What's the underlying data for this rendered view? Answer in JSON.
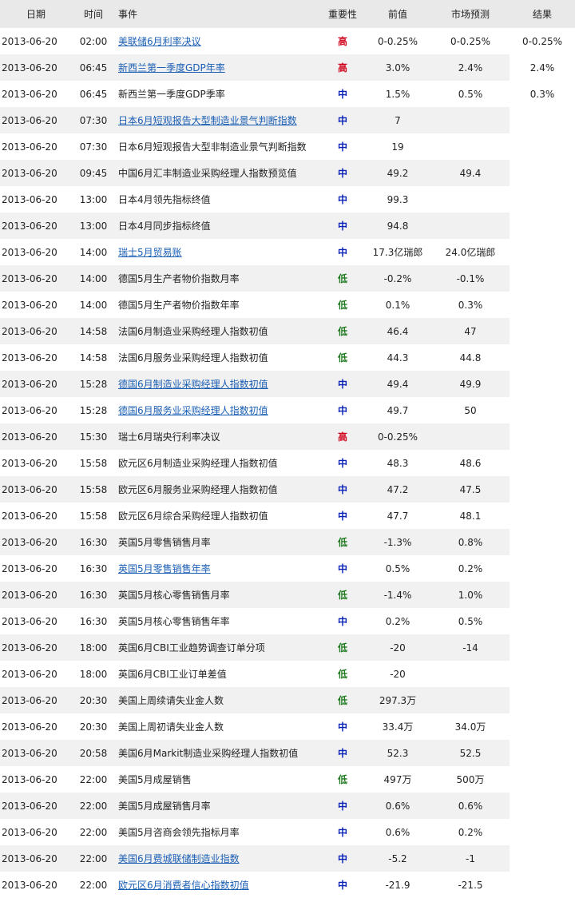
{
  "header": {
    "date": "日期",
    "time": "时间",
    "event": "事件",
    "importance": "重要性",
    "previous": "前值",
    "forecast": "市场预测",
    "result": "结果"
  },
  "rows": [
    {
      "date": "2013-06-20",
      "time": "02:00",
      "event": "美联储6月利率决议",
      "link": true,
      "importance": "高",
      "level": "high",
      "previous": "0-0.25%",
      "forecast": "0-0.25%",
      "result": "0-0.25%"
    },
    {
      "date": "2013-06-20",
      "time": "06:45",
      "event": "新西兰第一季度GDP年率",
      "link": true,
      "importance": "高",
      "level": "high",
      "previous": "3.0%",
      "forecast": "2.4%",
      "result": "2.4%"
    },
    {
      "date": "2013-06-20",
      "time": "06:45",
      "event": "新西兰第一季度GDP季率",
      "link": false,
      "importance": "中",
      "level": "mid",
      "previous": "1.5%",
      "forecast": "0.5%",
      "result": "0.3%"
    },
    {
      "date": "2013-06-20",
      "time": "07:30",
      "event": "日本6月短观报告大型制造业景气判断指数",
      "link": true,
      "importance": "中",
      "level": "mid",
      "previous": "7",
      "forecast": "",
      "result": ""
    },
    {
      "date": "2013-06-20",
      "time": "07:30",
      "event": "日本6月短观报告大型非制造业景气判断指数",
      "link": false,
      "importance": "中",
      "level": "mid",
      "previous": "19",
      "forecast": "",
      "result": ""
    },
    {
      "date": "2013-06-20",
      "time": "09:45",
      "event": "中国6月汇丰制造业采购经理人指数预览值",
      "link": false,
      "importance": "中",
      "level": "mid",
      "previous": "49.2",
      "forecast": "49.4",
      "result": ""
    },
    {
      "date": "2013-06-20",
      "time": "13:00",
      "event": "日本4月领先指标终值",
      "link": false,
      "importance": "中",
      "level": "mid",
      "previous": "99.3",
      "forecast": "",
      "result": ""
    },
    {
      "date": "2013-06-20",
      "time": "13:00",
      "event": "日本4月同步指标终值",
      "link": false,
      "importance": "中",
      "level": "mid",
      "previous": "94.8",
      "forecast": "",
      "result": ""
    },
    {
      "date": "2013-06-20",
      "time": "14:00",
      "event": "瑞士5月贸易账",
      "link": true,
      "importance": "中",
      "level": "mid",
      "previous": "17.3亿瑞郎",
      "forecast": "24.0亿瑞郎",
      "result": ""
    },
    {
      "date": "2013-06-20",
      "time": "14:00",
      "event": "德国5月生产者物价指数月率",
      "link": false,
      "importance": "低",
      "level": "low",
      "previous": "-0.2%",
      "forecast": "-0.1%",
      "result": ""
    },
    {
      "date": "2013-06-20",
      "time": "14:00",
      "event": "德国5月生产者物价指数年率",
      "link": false,
      "importance": "低",
      "level": "low",
      "previous": "0.1%",
      "forecast": "0.3%",
      "result": ""
    },
    {
      "date": "2013-06-20",
      "time": "14:58",
      "event": "法国6月制造业采购经理人指数初值",
      "link": false,
      "importance": "低",
      "level": "low",
      "previous": "46.4",
      "forecast": "47",
      "result": ""
    },
    {
      "date": "2013-06-20",
      "time": "14:58",
      "event": "法国6月服务业采购经理人指数初值",
      "link": false,
      "importance": "低",
      "level": "low",
      "previous": "44.3",
      "forecast": "44.8",
      "result": ""
    },
    {
      "date": "2013-06-20",
      "time": "15:28",
      "event": "德国6月制造业采购经理人指数初值",
      "link": true,
      "importance": "中",
      "level": "mid",
      "previous": "49.4",
      "forecast": "49.9",
      "result": ""
    },
    {
      "date": "2013-06-20",
      "time": "15:28",
      "event": "德国6月服务业采购经理人指数初值",
      "link": true,
      "importance": "中",
      "level": "mid",
      "previous": "49.7",
      "forecast": "50",
      "result": ""
    },
    {
      "date": "2013-06-20",
      "time": "15:30",
      "event": "瑞士6月瑞央行利率决议",
      "link": false,
      "importance": "高",
      "level": "high",
      "previous": "0-0.25%",
      "forecast": "",
      "result": ""
    },
    {
      "date": "2013-06-20",
      "time": "15:58",
      "event": "欧元区6月制造业采购经理人指数初值",
      "link": false,
      "importance": "中",
      "level": "mid",
      "previous": "48.3",
      "forecast": "48.6",
      "result": ""
    },
    {
      "date": "2013-06-20",
      "time": "15:58",
      "event": "欧元区6月服务业采购经理人指数初值",
      "link": false,
      "importance": "中",
      "level": "mid",
      "previous": "47.2",
      "forecast": "47.5",
      "result": ""
    },
    {
      "date": "2013-06-20",
      "time": "15:58",
      "event": "欧元区6月综合采购经理人指数初值",
      "link": false,
      "importance": "中",
      "level": "mid",
      "previous": "47.7",
      "forecast": "48.1",
      "result": ""
    },
    {
      "date": "2013-06-20",
      "time": "16:30",
      "event": "英国5月零售销售月率",
      "link": false,
      "importance": "低",
      "level": "low",
      "previous": "-1.3%",
      "forecast": "0.8%",
      "result": ""
    },
    {
      "date": "2013-06-20",
      "time": "16:30",
      "event": "英国5月零售销售年率",
      "link": true,
      "importance": "中",
      "level": "mid",
      "previous": "0.5%",
      "forecast": "0.2%",
      "result": ""
    },
    {
      "date": "2013-06-20",
      "time": "16:30",
      "event": "英国5月核心零售销售月率",
      "link": false,
      "importance": "低",
      "level": "low",
      "previous": "-1.4%",
      "forecast": "1.0%",
      "result": ""
    },
    {
      "date": "2013-06-20",
      "time": "16:30",
      "event": "英国5月核心零售销售年率",
      "link": false,
      "importance": "中",
      "level": "mid",
      "previous": "0.2%",
      "forecast": "0.5%",
      "result": ""
    },
    {
      "date": "2013-06-20",
      "time": "18:00",
      "event": "英国6月CBI工业趋势调查订单分项",
      "link": false,
      "importance": "低",
      "level": "low",
      "previous": "-20",
      "forecast": "-14",
      "result": ""
    },
    {
      "date": "2013-06-20",
      "time": "18:00",
      "event": "英国6月CBI工业订单差值",
      "link": false,
      "importance": "低",
      "level": "low",
      "previous": "-20",
      "forecast": "",
      "result": ""
    },
    {
      "date": "2013-06-20",
      "time": "20:30",
      "event": "美国上周续请失业金人数",
      "link": false,
      "importance": "低",
      "level": "low",
      "previous": "297.3万",
      "forecast": "",
      "result": ""
    },
    {
      "date": "2013-06-20",
      "time": "20:30",
      "event": "美国上周初请失业金人数",
      "link": false,
      "importance": "中",
      "level": "mid",
      "previous": "33.4万",
      "forecast": "34.0万",
      "result": ""
    },
    {
      "date": "2013-06-20",
      "time": "20:58",
      "event": "美国6月Markit制造业采购经理人指数初值",
      "link": false,
      "importance": "中",
      "level": "mid",
      "previous": "52.3",
      "forecast": "52.5",
      "result": ""
    },
    {
      "date": "2013-06-20",
      "time": "22:00",
      "event": "美国5月成屋销售",
      "link": false,
      "importance": "低",
      "level": "low",
      "previous": "497万",
      "forecast": "500万",
      "result": ""
    },
    {
      "date": "2013-06-20",
      "time": "22:00",
      "event": "美国5月成屋销售月率",
      "link": false,
      "importance": "中",
      "level": "mid",
      "previous": "0.6%",
      "forecast": "0.6%",
      "result": ""
    },
    {
      "date": "2013-06-20",
      "time": "22:00",
      "event": "美国5月咨商会领先指标月率",
      "link": false,
      "importance": "中",
      "level": "mid",
      "previous": "0.6%",
      "forecast": "0.2%",
      "result": ""
    },
    {
      "date": "2013-06-20",
      "time": "22:00",
      "event": "美国6月费城联储制造业指数",
      "link": true,
      "importance": "中",
      "level": "mid",
      "previous": "-5.2",
      "forecast": "-1",
      "result": ""
    },
    {
      "date": "2013-06-20",
      "time": "22:00",
      "event": "欧元区6月消费者信心指数初值",
      "link": true,
      "importance": "中",
      "level": "mid",
      "previous": "-21.9",
      "forecast": "-21.5",
      "result": ""
    }
  ]
}
